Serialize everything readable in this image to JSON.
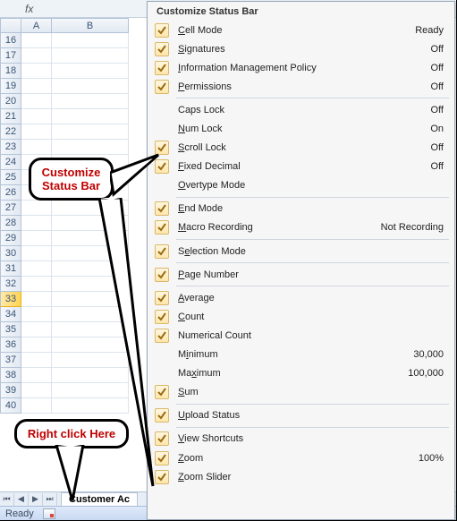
{
  "formula_bar": {
    "fx_label": "fx"
  },
  "columns": [
    "A",
    "B"
  ],
  "row_start": 16,
  "row_end": 40,
  "active_row": 33,
  "sheet_tab": "Customer Ac",
  "status": {
    "text": "Ready"
  },
  "menu": {
    "title": "Customize Status Bar",
    "groups": [
      [
        {
          "checked": true,
          "label": "Cell Mode",
          "u": 0,
          "value": "Ready"
        },
        {
          "checked": true,
          "label": "Signatures",
          "u": 0,
          "value": "Off"
        },
        {
          "checked": true,
          "label": "Information Management Policy",
          "u": 0,
          "value": "Off"
        },
        {
          "checked": true,
          "label": "Permissions",
          "u": 0,
          "value": "Off"
        }
      ],
      [
        {
          "checked": false,
          "label": "Caps Lock",
          "u": -1,
          "value": "Off"
        },
        {
          "checked": false,
          "label": "Num Lock",
          "u": 0,
          "value": "On"
        },
        {
          "checked": true,
          "label": "Scroll Lock",
          "u": 0,
          "value": "Off"
        },
        {
          "checked": true,
          "label": "Fixed Decimal",
          "u": 0,
          "value": "Off"
        },
        {
          "checked": false,
          "label": "Overtype Mode",
          "u": 0,
          "value": ""
        }
      ],
      [
        {
          "checked": true,
          "label": "End Mode",
          "u": 0,
          "value": ""
        },
        {
          "checked": true,
          "label": "Macro Recording",
          "u": 0,
          "value": "Not Recording"
        }
      ],
      [
        {
          "checked": true,
          "label": "Selection Mode",
          "u": 1,
          "value": ""
        }
      ],
      [
        {
          "checked": true,
          "label": "Page Number",
          "u": 0,
          "value": ""
        }
      ],
      [
        {
          "checked": true,
          "label": "Average",
          "u": 0,
          "value": ""
        },
        {
          "checked": true,
          "label": "Count",
          "u": 0,
          "value": ""
        },
        {
          "checked": true,
          "label": "Numerical Count",
          "u": -1,
          "value": ""
        },
        {
          "checked": false,
          "label": "Minimum",
          "u": 1,
          "value": "30,000"
        },
        {
          "checked": false,
          "label": "Maximum",
          "u": 2,
          "value": "100,000"
        },
        {
          "checked": true,
          "label": "Sum",
          "u": 0,
          "value": ""
        }
      ],
      [
        {
          "checked": true,
          "label": "Upload Status",
          "u": 0,
          "value": ""
        }
      ],
      [
        {
          "checked": true,
          "label": "View Shortcuts",
          "u": 0,
          "value": ""
        },
        {
          "checked": true,
          "label": "Zoom",
          "u": 0,
          "value": "100%"
        },
        {
          "checked": true,
          "label": "Zoom Slider",
          "u": 0,
          "value": ""
        }
      ]
    ]
  },
  "callouts": {
    "customize": "Customize\nStatus Bar",
    "rightclick": "Right click Here"
  }
}
